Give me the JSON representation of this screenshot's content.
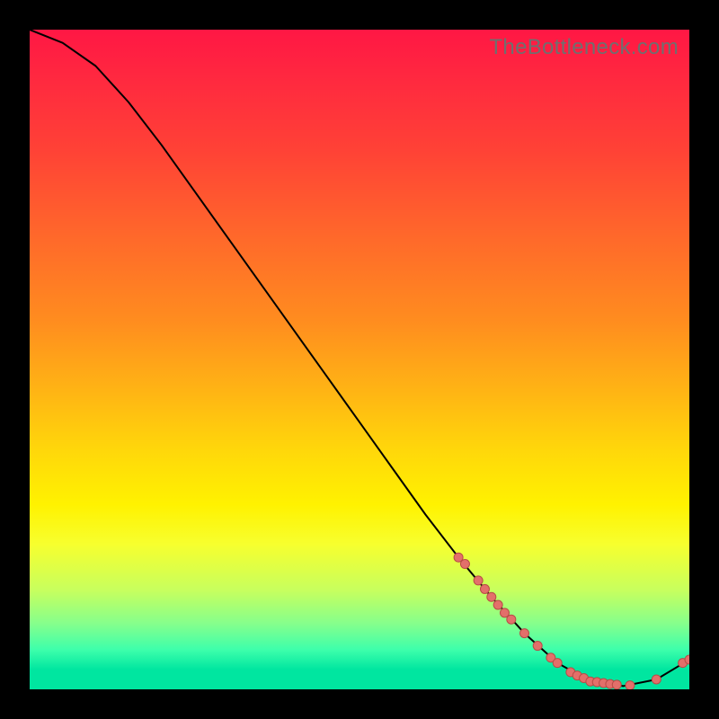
{
  "watermark": "TheBottleneck.com",
  "colors": {
    "curve": "#000000",
    "point_fill": "#e36f6a",
    "point_stroke": "#b94b46"
  },
  "chart_data": {
    "type": "line",
    "title": "",
    "xlabel": "",
    "ylabel": "",
    "xlim": [
      0,
      100
    ],
    "ylim": [
      0,
      100
    ],
    "series": [
      {
        "name": "curve",
        "x": [
          0,
          5,
          10,
          15,
          20,
          25,
          30,
          35,
          40,
          45,
          50,
          55,
          60,
          65,
          70,
          75,
          80,
          85,
          90,
          95,
          100
        ],
        "y": [
          100,
          98,
          94.5,
          89,
          82.5,
          75.5,
          68.5,
          61.5,
          54.5,
          47.5,
          40.5,
          33.5,
          26.5,
          20,
          14,
          8.5,
          4,
          1.2,
          0.5,
          1.5,
          4.5
        ]
      }
    ],
    "points": {
      "name": "markers",
      "x": [
        65,
        66,
        68,
        69,
        70,
        71,
        72,
        73,
        75,
        77,
        79,
        80,
        82,
        83,
        84,
        85,
        86,
        87,
        88,
        89,
        91,
        95,
        99,
        100
      ],
      "y": [
        20,
        19,
        16.5,
        15.2,
        14,
        12.8,
        11.6,
        10.6,
        8.5,
        6.6,
        4.8,
        4,
        2.6,
        2.1,
        1.7,
        1.2,
        1.1,
        0.95,
        0.8,
        0.7,
        0.6,
        1.5,
        4,
        4.5
      ]
    }
  }
}
